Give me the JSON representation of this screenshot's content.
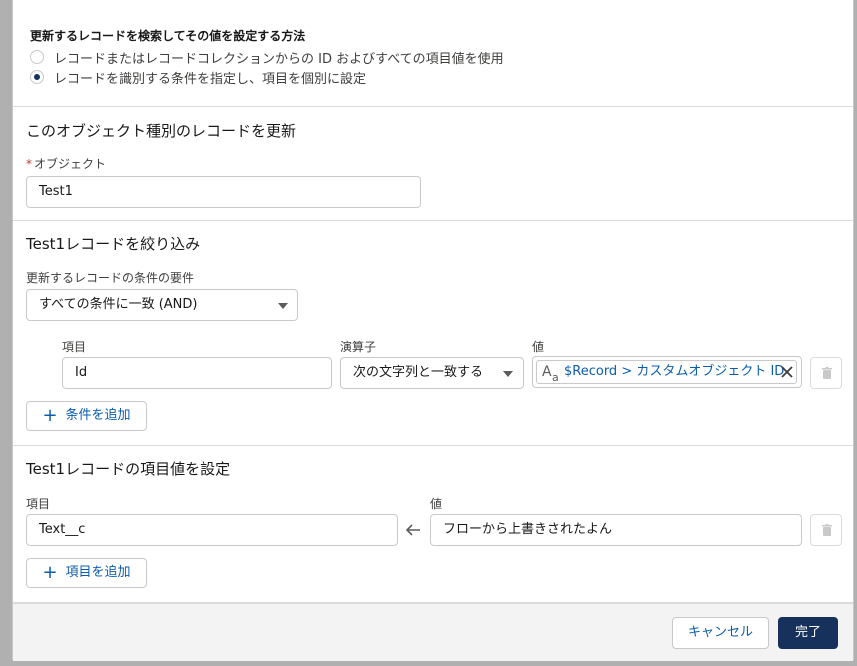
{
  "how": {
    "title": "更新するレコードを検索してその値を設定する方法",
    "options": [
      {
        "label": "レコードまたはレコードコレクションからの ID およびすべての項目値を使用",
        "checked": false
      },
      {
        "label": "レコードを識別する条件を指定し、項目を個別に設定",
        "checked": true
      }
    ]
  },
  "object_section": {
    "title": "このオブジェクト種別のレコードを更新",
    "object_label": "オブジェクト",
    "object_value": "Test1"
  },
  "filter_section": {
    "title": "Test1レコードを絞り込み",
    "condition_label": "更新するレコードの条件の要件",
    "condition_value": "すべての条件に一致 (AND)",
    "field_header": "項目",
    "operator_header": "演算子",
    "value_header": "値",
    "row": {
      "field": "Id",
      "operator": "次の文字列と一致する",
      "value": "$Record > カスタムオブジェクト ID"
    },
    "add_button": "条件を追加"
  },
  "set_section": {
    "title": "Test1レコードの項目値を設定",
    "field_header": "項目",
    "value_header": "値",
    "row": {
      "field": "Text__c",
      "value": "フローから上書きされたよん"
    },
    "add_button": "項目を追加"
  },
  "footer": {
    "cancel": "キャンセル",
    "done": "完了"
  },
  "colors": {
    "brand": "#16325c",
    "link": "#0b5cab",
    "required": "#c23934"
  },
  "icons": [
    "text-type-icon",
    "close-icon",
    "trash-icon",
    "arrow-left-icon",
    "add-icon",
    "chevron-down-icon"
  ]
}
